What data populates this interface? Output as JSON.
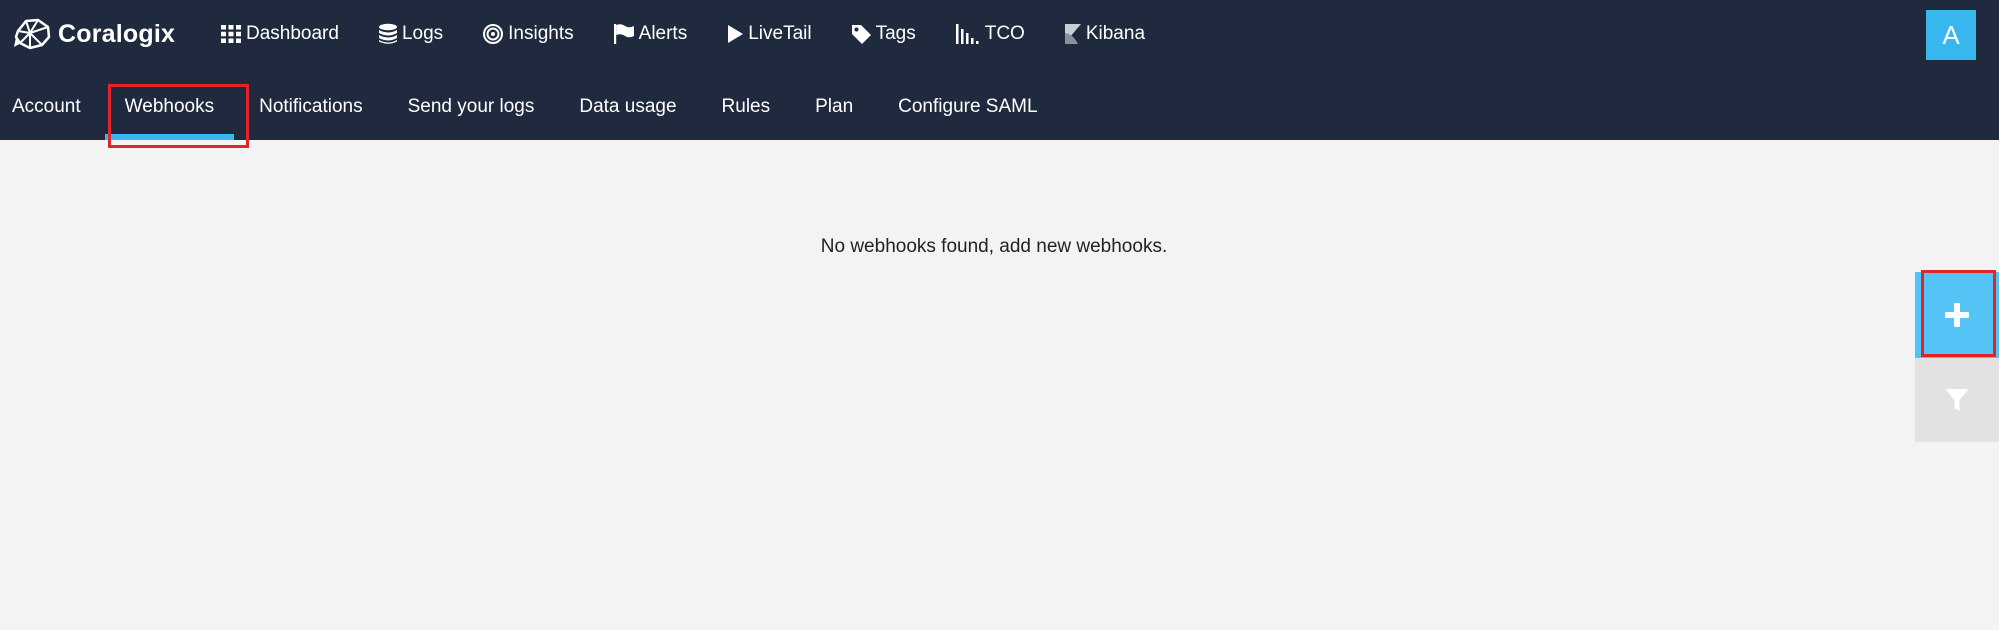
{
  "brand": {
    "name": "Coralogix"
  },
  "main_nav": [
    {
      "label": "Dashboard",
      "icon": "grid-icon"
    },
    {
      "label": "Logs",
      "icon": "database-icon"
    },
    {
      "label": "Insights",
      "icon": "target-icon"
    },
    {
      "label": "Alerts",
      "icon": "flag-icon"
    },
    {
      "label": "LiveTail",
      "icon": "play-icon"
    },
    {
      "label": "Tags",
      "icon": "tag-icon"
    },
    {
      "label": "TCO",
      "icon": "bar-chart-icon"
    },
    {
      "label": "Kibana",
      "icon": "kibana-icon"
    }
  ],
  "user": {
    "avatar_initial": "A"
  },
  "sub_nav": [
    {
      "label": "Account"
    },
    {
      "label": "Webhooks",
      "active": true
    },
    {
      "label": "Notifications"
    },
    {
      "label": "Send your logs"
    },
    {
      "label": "Data usage"
    },
    {
      "label": "Rules"
    },
    {
      "label": "Plan"
    },
    {
      "label": "Configure SAML"
    }
  ],
  "content": {
    "empty_message": "No webhooks found, add new webhooks."
  },
  "side_actions": {
    "add_icon": "plus-icon",
    "filter_icon": "filter-icon"
  },
  "colors": {
    "topbar": "#1f2a3e",
    "accent": "#37b7ee",
    "highlight": "#e0242a",
    "background": "#f3f3f3"
  }
}
